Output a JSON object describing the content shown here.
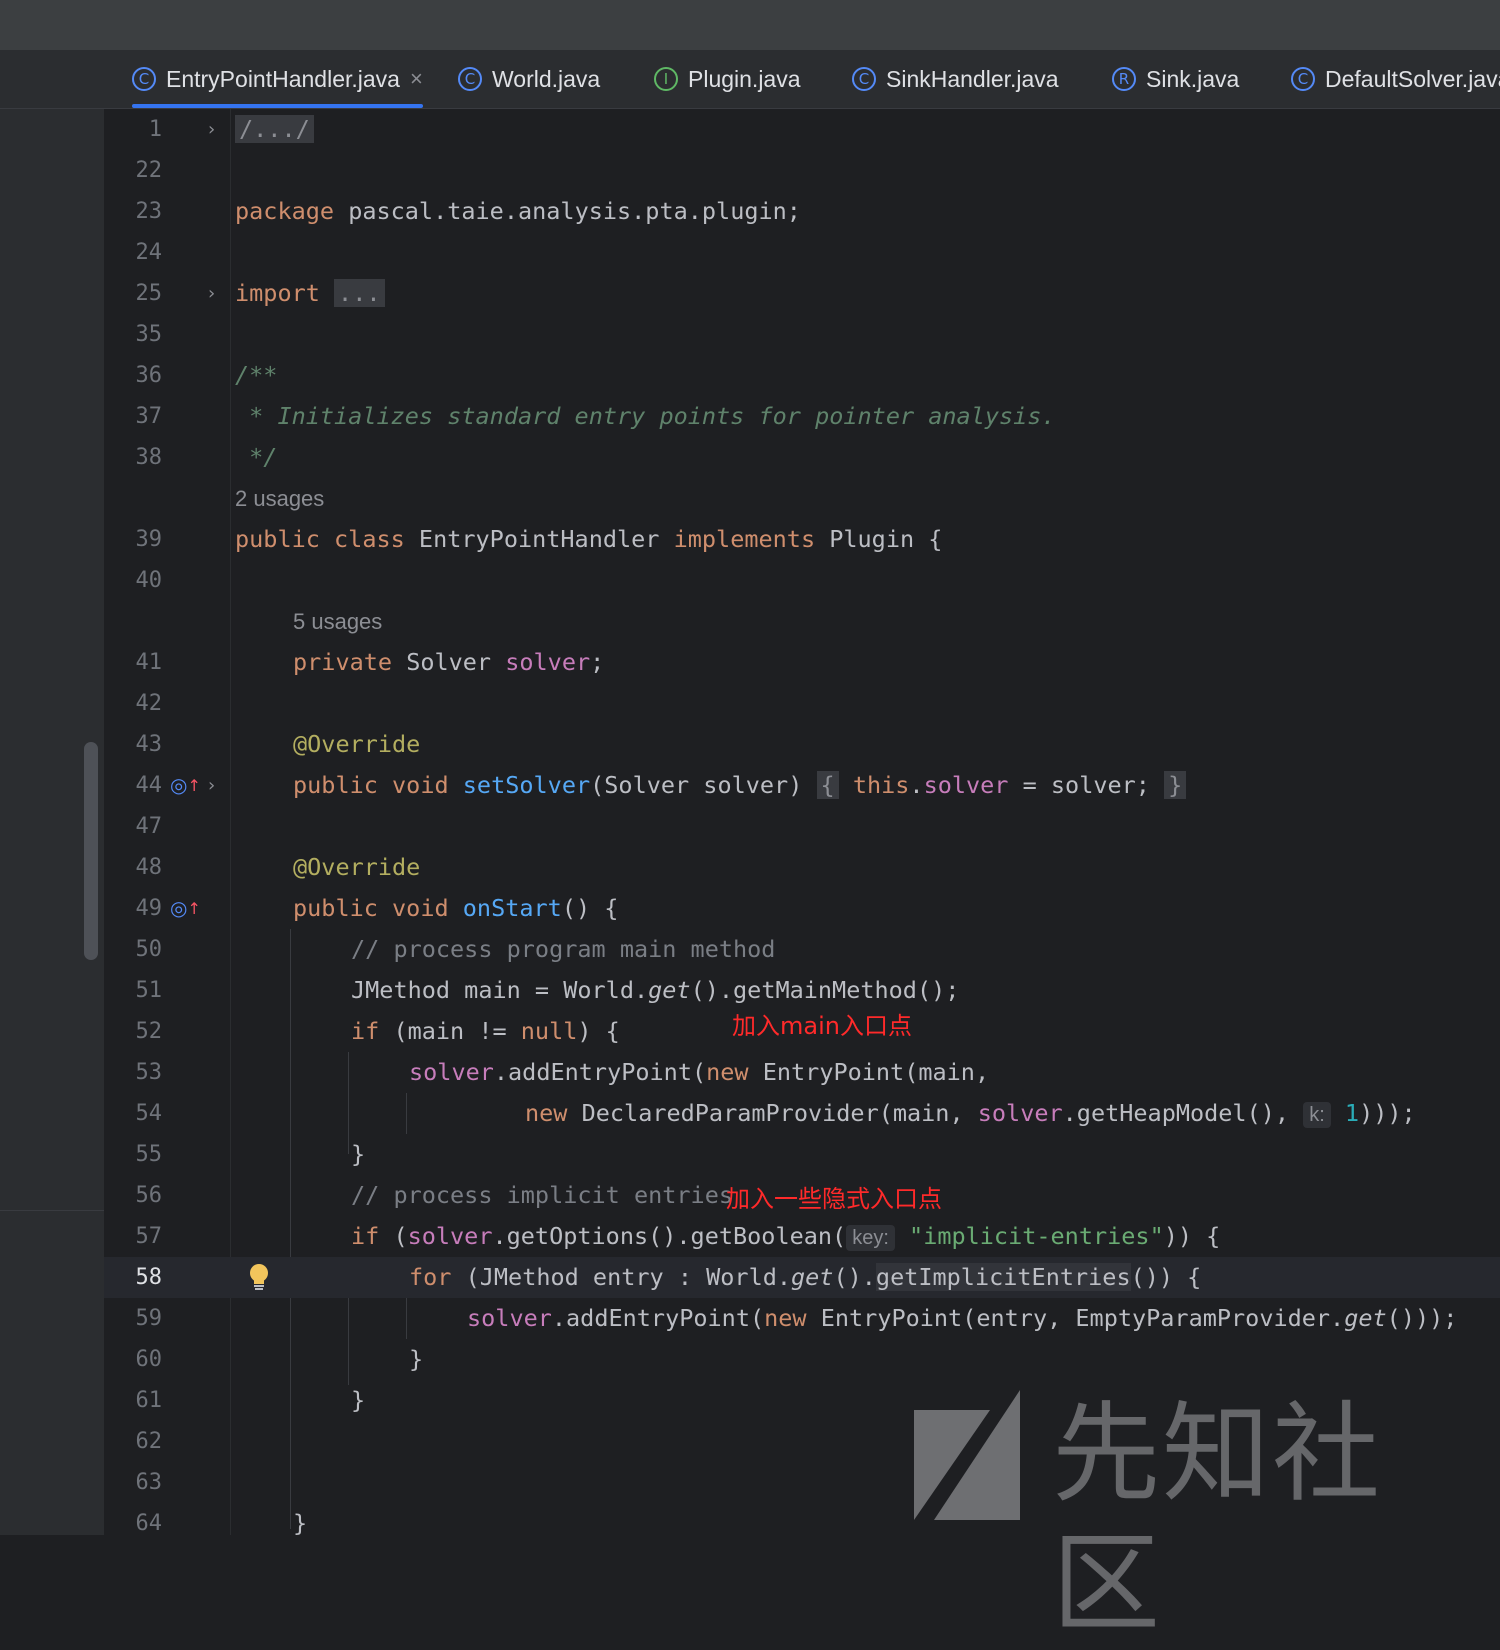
{
  "tabs": [
    {
      "icon": "C",
      "label": "EntryPointHandler.java",
      "close": "×"
    },
    {
      "icon": "C",
      "label": "World.java"
    },
    {
      "icon": "I",
      "label": "Plugin.java"
    },
    {
      "icon": "C",
      "label": "SinkHandler.java"
    },
    {
      "icon": "R",
      "label": "Sink.java"
    },
    {
      "icon": "C",
      "label": "DefaultSolver.java"
    }
  ],
  "editor": {
    "line_numbers": [
      "1",
      "22",
      "23",
      "24",
      "25",
      "35",
      "36",
      "37",
      "38",
      "39",
      "40",
      "41",
      "42",
      "43",
      "44",
      "47",
      "48",
      "49",
      "50",
      "51",
      "52",
      "53",
      "54",
      "55",
      "56",
      "57",
      "58",
      "59",
      "60",
      "61",
      "62",
      "63",
      "64"
    ],
    "current_line": "58",
    "usages": [
      "2 usages",
      "5 usages"
    ],
    "folded": [
      "/.../",
      "..."
    ],
    "code": {
      "package_kw": "package",
      "package_name": " pascal.taie.analysis.pta.plugin;",
      "import_kw": "import",
      "doc_open": "/**",
      "doc_body": " * Initializes standard entry points for pointer analysis.",
      "doc_close": " */",
      "class_decl": [
        "public class",
        " EntryPointHandler ",
        "implements",
        " Plugin {"
      ],
      "field_decl": [
        "private",
        " Solver ",
        "solver",
        ";"
      ],
      "override": "@Override",
      "set_solver": [
        "public void ",
        "setSolver",
        "(Solver solver) ",
        "{",
        " ",
        "this",
        ".",
        "solver",
        " = solver;",
        " ",
        "}"
      ],
      "on_start": [
        "public void ",
        "onStart",
        "() {"
      ],
      "comment_main": "// process program main method",
      "main_decl": [
        "JMethod main = World.",
        "get",
        "().getMainMethod();"
      ],
      "if_main": [
        "if",
        " (main != ",
        "null",
        ") {"
      ],
      "add_main": [
        "solver",
        ".addEntryPoint(",
        "new",
        " EntryPoint(main,"
      ],
      "declared": [
        "new",
        " DeclaredParamProvider(main, ",
        "solver",
        ".getHeapModel(), ",
        "k:",
        " ",
        "1",
        ")));"
      ],
      "close_brace": "}",
      "comment_implicit": "// process implicit entries",
      "if_implicit": [
        "if",
        " (",
        "solver",
        ".getOptions().getBoolean(",
        "key:",
        " ",
        "\"implicit-entries\"",
        ")) {"
      ],
      "for_loop": [
        "for",
        " (JMethod entry : World.",
        "get",
        "().",
        "getImplicitEntries",
        "()) {"
      ],
      "add_implicit": [
        "solver",
        ".addEntryPoint(",
        "new",
        " EntryPoint(entry, EmptyParamProvider.",
        "get",
        "()));"
      ]
    }
  },
  "annotations": {
    "main_note": "加入main入口点",
    "implicit_note": "加入一些隐式入口点"
  },
  "watermark": {
    "text": "先知社区"
  },
  "colors": {
    "keyword": "#cf8e6d",
    "annotation": "#b3ae60",
    "field": "#c77dbb",
    "method": "#56a8f5",
    "string": "#6aab73",
    "number": "#2aacb8",
    "note": "#ff2a2a"
  }
}
